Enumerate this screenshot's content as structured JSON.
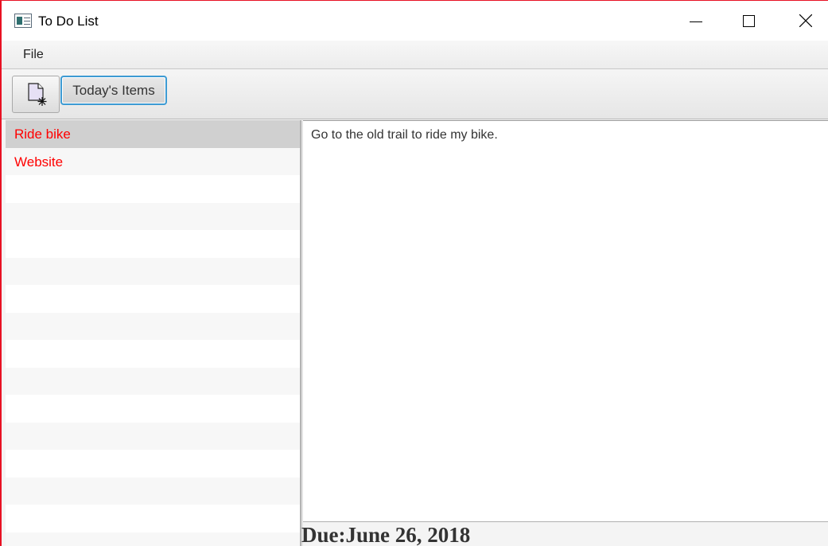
{
  "window": {
    "title": "To Do List"
  },
  "menubar": {
    "file_label": "File"
  },
  "toolbar": {
    "new_icon": "new-document-icon",
    "today_label": "Today's Items"
  },
  "list": {
    "items": [
      {
        "label": "Ride bike",
        "selected": true
      },
      {
        "label": "Website",
        "selected": false
      }
    ],
    "item_color": "#ff0000"
  },
  "details": {
    "description": "Go to the old trail to ride my bike.",
    "due_prefix": "Due:",
    "due_date": "June 26, 2018"
  },
  "colors": {
    "accent_focus": "#3d9bd3",
    "window_border": "#e81123"
  }
}
